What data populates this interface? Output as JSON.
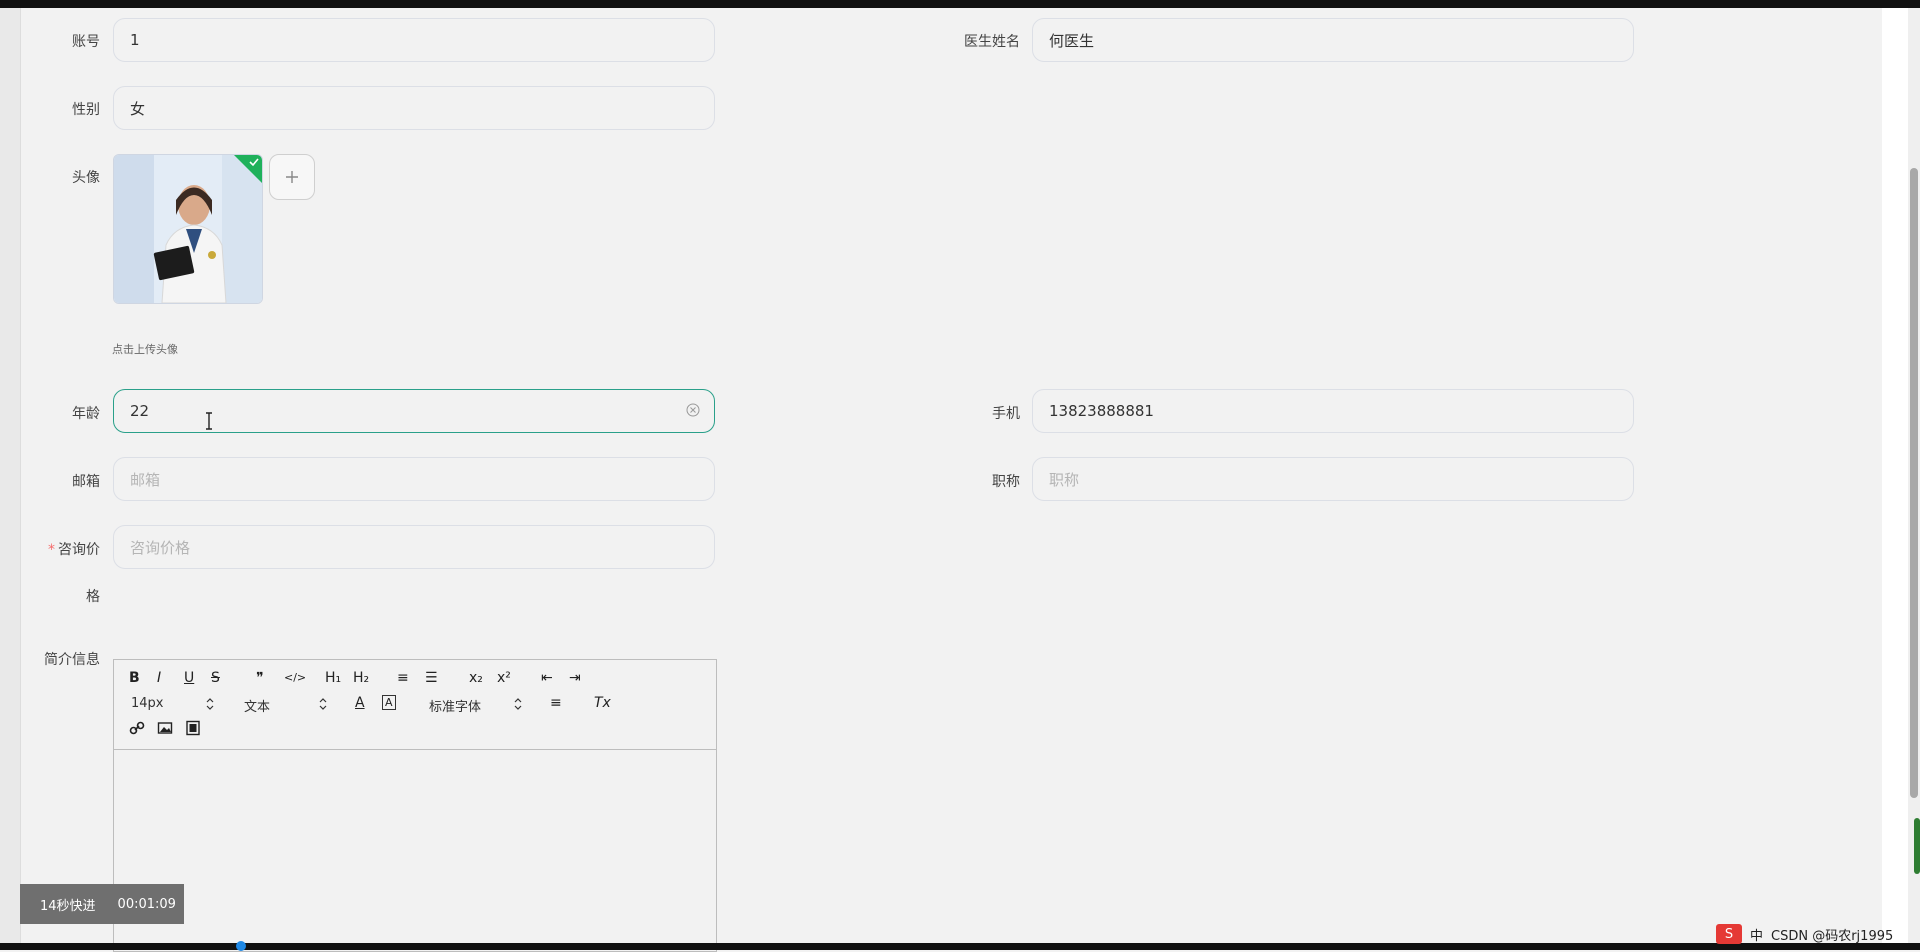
{
  "form": {
    "account_label": "账号",
    "account_value": "1",
    "doctor_name_label": "医生姓名",
    "doctor_name_value": "何医生",
    "gender_label": "性别",
    "gender_value": "女",
    "avatar_label": "头像",
    "upload_hint": "点击上传头像",
    "age_label": "年龄",
    "age_value": "22",
    "phone_label": "手机",
    "phone_value": "13823888881",
    "email_label": "邮箱",
    "email_placeholder": "邮箱",
    "title_label": "职称",
    "title_placeholder": "职称",
    "price_label_line1": "咨询价",
    "price_label_line2": "格",
    "price_required_mark": "*",
    "price_placeholder": "咨询价格",
    "intro_label": "简介信息"
  },
  "editor": {
    "bold": "B",
    "italic": "I",
    "underline": "U",
    "strike": "S",
    "quote": "❞",
    "code": "</>",
    "h1": "H₁",
    "h2": "H₂",
    "ordered_list": "≡",
    "bullet_list": "☰",
    "subscript": "x₂",
    "superscript": "x²",
    "outdent": "⇤",
    "indent": "⇥",
    "font_size": "14px",
    "text_type": "文本",
    "font_family": "标准字体",
    "font_color": "A",
    "bg_color": "A",
    "align": "≡",
    "clear_format": "Tx"
  },
  "overlay": {
    "speed_text": "14秒快进",
    "time_text": "00:01:09"
  },
  "tray": {
    "logo_text": "S",
    "ime_text": "中",
    "watermark_text": "CSDN @码农rj1995"
  },
  "colors": {
    "accent_focus": "#2aa08a",
    "required": "#f56c6c",
    "check_badge": "#1fb15b"
  },
  "icons": [
    "clear-icon",
    "text-cursor-icon",
    "check-icon",
    "plus-icon",
    "link-icon",
    "image-icon",
    "video-icon",
    "caret-icon"
  ]
}
